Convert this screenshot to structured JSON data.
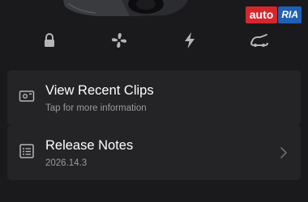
{
  "watermark": {
    "part1": "auto",
    "part2": "RIA"
  },
  "quick_controls": [
    {
      "icon": "lock-icon"
    },
    {
      "icon": "fan-icon"
    },
    {
      "icon": "bolt-icon"
    },
    {
      "icon": "trunk-open-icon"
    }
  ],
  "clips_card": {
    "title": "View Recent Clips",
    "subtitle": "Tap for more information",
    "icon": "dashcam-icon"
  },
  "release_card": {
    "title": "Release Notes",
    "version": "2026.14.3",
    "icon": "notes-list-icon",
    "chevron": "chevron-right-icon"
  },
  "colors": {
    "background": "#1a1a1c",
    "card": "#242427",
    "icon": "#b5b5b8",
    "subtitle": "#9a9a9e",
    "watermark_red": "#d7262b",
    "watermark_blue": "#1f5fb4"
  }
}
